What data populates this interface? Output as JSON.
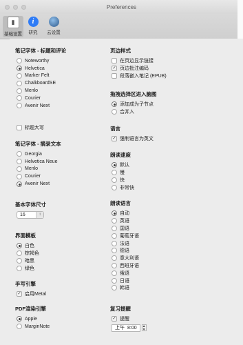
{
  "window": {
    "title": "Preferences"
  },
  "toolbar": {
    "tabs": [
      {
        "label": "基础设置"
      },
      {
        "label": "研究"
      },
      {
        "label": "云设置"
      }
    ]
  },
  "left": {
    "font_title": {
      "heading": "笔记字体 - 标题和评论",
      "options": [
        "Noteworthy",
        "Helvetica",
        "Marker Felt",
        "ChalkboardSE",
        "Menlo",
        "Courier",
        "Avenir Next"
      ],
      "selected": "Helvetica"
    },
    "uppercase_label": "标题大写",
    "excerpt_font": {
      "heading": "笔记字体 - 摘录文本",
      "options": [
        "Georgia",
        "Helvetica Neue",
        "Menlo",
        "Courier",
        "Avenir Next"
      ],
      "selected": "Avenir Next"
    },
    "base_size": {
      "heading": "基本字体尺寸",
      "value": "16"
    },
    "theme": {
      "heading": "界面模板",
      "options": [
        "白色",
        "棕褐色",
        "暗黑",
        "绿色"
      ],
      "selected": "白色"
    },
    "handwriting": {
      "heading": "手写引擎",
      "checkbox_label": "启用Metal"
    },
    "pdf_engine": {
      "heading": "PDF渲染引擎",
      "options": [
        "Apple",
        "MarginNote"
      ],
      "selected": "Apple"
    }
  },
  "right": {
    "margin_style": {
      "heading": "页边样式",
      "checks": [
        {
          "label": "在页边显示链接",
          "checked": false
        },
        {
          "label": "页边批注编码",
          "checked": true
        },
        {
          "label": "段落嵌入笔记 (EPUB)",
          "checked": false
        }
      ]
    },
    "drag_select": {
      "heading": "拖拽选择区进入脑图",
      "options": [
        "添加成为子节点",
        "合并入"
      ],
      "selected": "添加成为子节点"
    },
    "language": {
      "heading": "语言",
      "checkbox_label": "强制语言为英文"
    },
    "read_speed": {
      "heading": "朗读速度",
      "options": [
        "默认",
        "慢",
        "快",
        "非常快"
      ],
      "selected": "默认"
    },
    "read_lang": {
      "heading": "朗读语言",
      "options": [
        "自动",
        "英语",
        "国语",
        "葡萄牙语",
        "法语",
        "德语",
        "意大利语",
        "西班牙语",
        "俄语",
        "日语",
        "韩语"
      ],
      "selected": "自动"
    },
    "review": {
      "heading": "复习提醒",
      "checkbox_label": "提醒",
      "time_ampm": "上午",
      "time_value": "8:00"
    }
  }
}
